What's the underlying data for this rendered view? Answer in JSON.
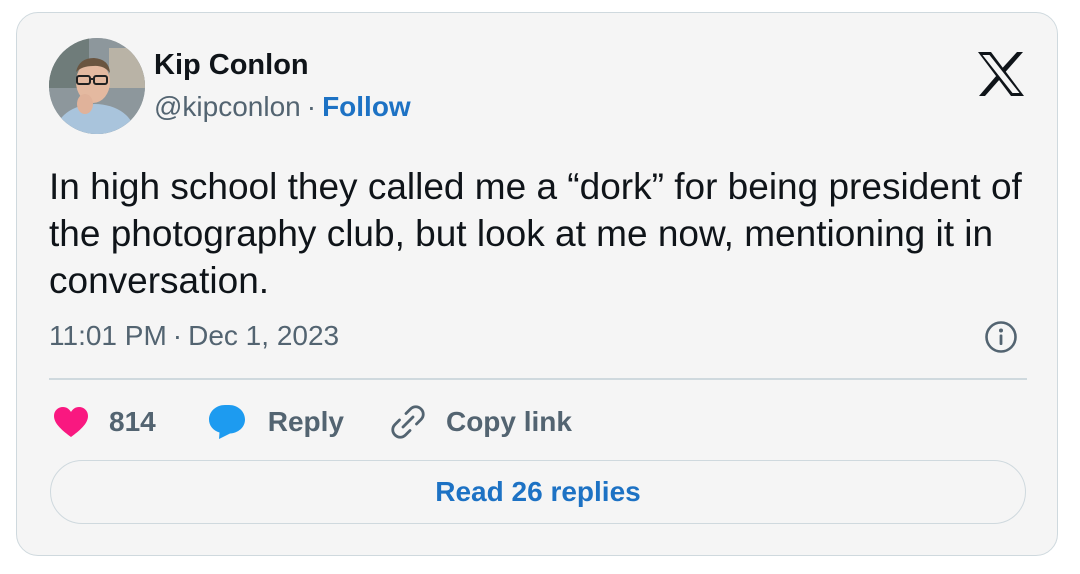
{
  "author": {
    "name": "Kip Conlon",
    "handle": "@kipconlon",
    "separator": "·",
    "follow_label": "Follow"
  },
  "tweet": {
    "text": "In high school they called me a “dork” for being president of the photography club, but look at me now, mentioning it in conversation.",
    "time": "11:01 PM",
    "separator": "·",
    "date": "Dec 1, 2023"
  },
  "actions": {
    "like_count": "814",
    "reply_label": "Reply",
    "copy_label": "Copy link"
  },
  "read_replies_label": "Read 26 replies",
  "icons": {
    "logo": "x-logo-icon",
    "info": "info-icon",
    "like": "heart-icon",
    "reply": "speech-bubble-icon",
    "copy": "link-icon"
  },
  "colors": {
    "card_bg": "#f5f5f5",
    "border": "#cfd9de",
    "text_primary": "#0f1419",
    "text_secondary": "#536471",
    "link_blue": "#1d72c4",
    "heart": "#f91880",
    "reply_icon": "#1d9bf0"
  }
}
